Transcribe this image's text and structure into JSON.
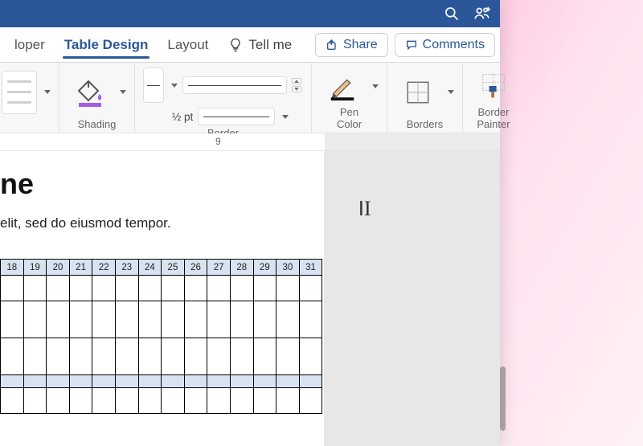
{
  "titlebar": {
    "search_icon": "search-icon",
    "share_presence_icon": "people-icon"
  },
  "tabs": {
    "developer": "loper",
    "table_design": "Table Design",
    "layout": "Layout",
    "tell_me": "Tell me"
  },
  "actions": {
    "share": "Share",
    "comments": "Comments"
  },
  "ribbon": {
    "shading": "Shading",
    "border_styles": "Border\nStyles",
    "weight": "½ pt",
    "pen_color": "Pen\nColor",
    "borders": "Borders",
    "border_painter": "Border\nPainter"
  },
  "ruler": {
    "mark": "9"
  },
  "document": {
    "heading_fragment": "ne",
    "paragraph_fragment": "elit, sed do eiusmod tempor."
  },
  "table": {
    "days": [
      "18",
      "19",
      "20",
      "21",
      "22",
      "23",
      "24",
      "25",
      "26",
      "27",
      "28",
      "29",
      "30",
      "31"
    ]
  }
}
